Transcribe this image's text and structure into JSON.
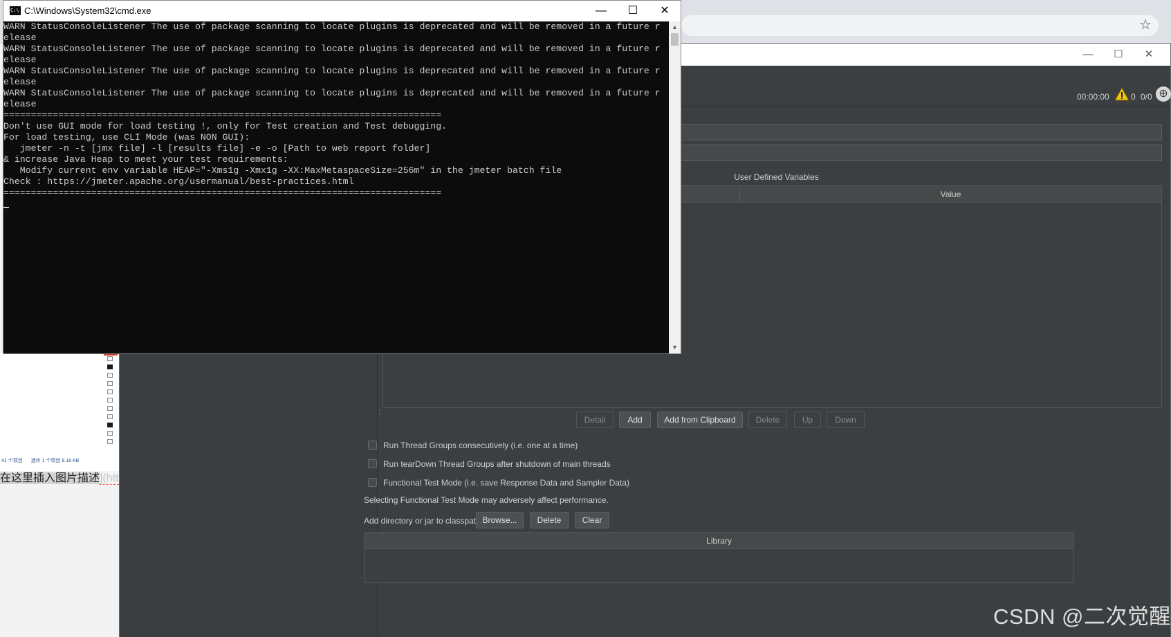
{
  "cmd": {
    "title": "C:\\Windows\\System32\\cmd.exe",
    "icon_text": "C:\\",
    "minimize": "—",
    "maximize": "☐",
    "close": "✕",
    "lines": [
      "WARN StatusConsoleListener The use of package scanning to locate plugins is deprecated and will be removed in a future r",
      "elease",
      "WARN StatusConsoleListener The use of package scanning to locate plugins is deprecated and will be removed in a future r",
      "elease",
      "WARN StatusConsoleListener The use of package scanning to locate plugins is deprecated and will be removed in a future r",
      "elease",
      "WARN StatusConsoleListener The use of package scanning to locate plugins is deprecated and will be removed in a future r",
      "elease",
      "================================================================================",
      "Don't use GUI mode for load testing !, only for Test creation and Test debugging.",
      "For load testing, use CLI Mode (was NON GUI):",
      "   jmeter -n -t [jmx file] -l [results file] -e -o [Path to web report folder]",
      "& increase Java Heap to meet your test requirements:",
      "   Modify current env variable HEAP=\"-Xms1g -Xmx1g -XX:MaxMetaspaceSize=256m\" in the jmeter batch file",
      "Check : https://jmeter.apache.org/usermanual/best-practices.html",
      "================================================================================"
    ]
  },
  "browser": {
    "star_icon": "☆"
  },
  "explorer": {
    "status_items": "41 个项目",
    "status_selected": "选中 1 个项目  8.18 KB"
  },
  "editor": {
    "selected_text": "在这里插入图片描述",
    "link_text": "](htt"
  },
  "jmeter": {
    "window_controls": {
      "minimize": "—",
      "maximize": "☐",
      "close": "✕"
    },
    "toolbar": {
      "timer": "00:00:00",
      "error_count": "0",
      "threads": "0/0"
    },
    "user_defined_variables_title": "User Defined Variables",
    "table_headers": {
      "name": "",
      "value": "Value"
    },
    "buttons": {
      "detail": "Detail",
      "add": "Add",
      "add_from_clipboard": "Add from Clipboard",
      "delete": "Delete",
      "up": "Up",
      "down": "Down"
    },
    "checkboxes": {
      "run_consecutively": "Run Thread Groups consecutively (i.e. one at a time)",
      "run_teardown": "Run tearDown Thread Groups after shutdown of main threads",
      "functional_mode": "Functional Test Mode (i.e. save Response Data and Sampler Data)"
    },
    "functional_note": "Selecting Functional Test Mode may adversely affect performance.",
    "classpath_label": "Add directory or jar to classpath",
    "classpath_buttons": {
      "browse": "Browse...",
      "delete": "Delete",
      "clear": "Clear"
    },
    "library_header": "Library"
  },
  "watermark": "CSDN @二次觉醒",
  "colors": {
    "cmd_background": "#0c0c0c",
    "cmd_text": "#cccccc",
    "jmeter_background": "#3c3f41",
    "warning_yellow": "#f0c419"
  }
}
